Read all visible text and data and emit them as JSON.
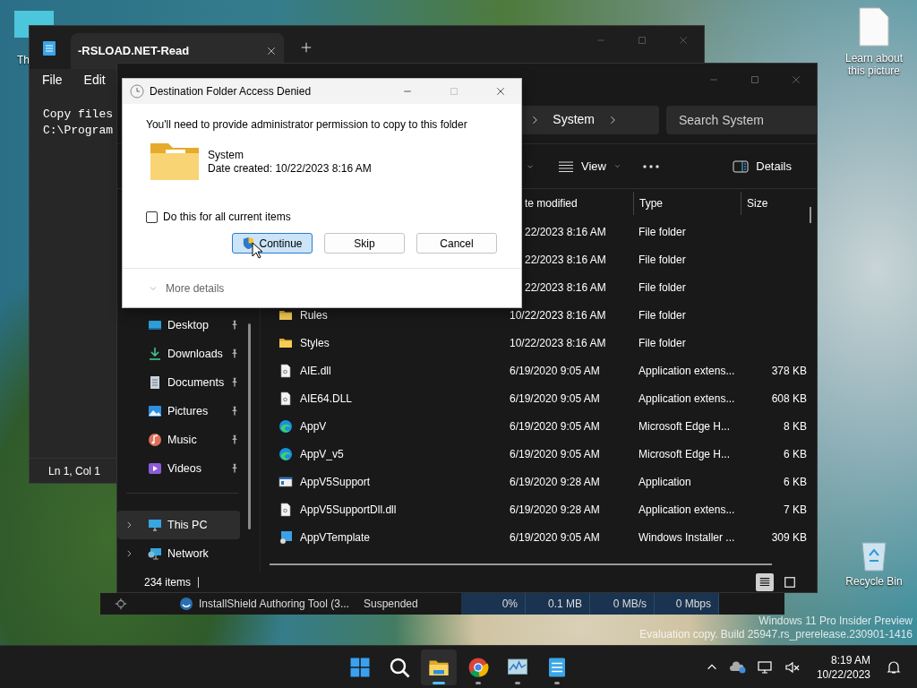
{
  "desktop": {
    "icons": [
      {
        "kind": "partial",
        "label": "Th"
      },
      {
        "kind": "document",
        "label": "Learn about this picture"
      },
      {
        "kind": "recycle",
        "label": "Recycle Bin"
      }
    ],
    "watermark": [
      "Windows 11 Pro Insider Preview",
      "Evaluation copy. Build 25947.rs_prerelease.230901-1416"
    ]
  },
  "notepad": {
    "tab": "-RSLOAD.NET-Read",
    "menu": [
      "File",
      "Edit"
    ],
    "text_lines": [
      "Copy files",
      "C:\\Program"
    ],
    "status": "Ln 1, Col 1"
  },
  "explorer": {
    "path": [
      "System"
    ],
    "search": {
      "placeholder": "Search System"
    },
    "toolbar": {
      "view": "View",
      "details": "Details"
    },
    "sidebar": [
      {
        "kind": "desktop",
        "label": "Desktop",
        "pinned": true,
        "expandable": false,
        "selected": false
      },
      {
        "kind": "downloads",
        "label": "Downloads",
        "pinned": true,
        "expandable": false,
        "selected": false
      },
      {
        "kind": "documents",
        "label": "Documents",
        "pinned": true,
        "expandable": false,
        "selected": false
      },
      {
        "kind": "pictures",
        "label": "Pictures",
        "pinned": true,
        "expandable": false,
        "selected": false
      },
      {
        "kind": "music",
        "label": "Music",
        "pinned": true,
        "expandable": false,
        "selected": false
      },
      {
        "kind": "videos",
        "label": "Videos",
        "pinned": true,
        "expandable": false,
        "selected": false
      },
      {
        "kind": "thispc",
        "label": "This PC",
        "pinned": false,
        "expandable": true,
        "selected": true
      },
      {
        "kind": "network",
        "label": "Network",
        "pinned": false,
        "expandable": true,
        "selected": false
      }
    ],
    "columns": [
      "te modified",
      "Type",
      "Size"
    ],
    "rows": [
      {
        "date": "22/2023 8:16 AM",
        "type": "File folder"
      },
      {
        "date": "22/2023 8:16 AM",
        "type": "File folder"
      },
      {
        "date": "22/2023 8:16 AM",
        "type": "File folder"
      },
      {
        "kind": "folder",
        "name": "Rules",
        "date": "10/22/2023 8:16 AM",
        "type": "File folder"
      },
      {
        "kind": "folder",
        "name": "Styles",
        "date": "10/22/2023 8:16 AM",
        "type": "File folder"
      },
      {
        "kind": "dll",
        "name": "AIE.dll",
        "date": "6/19/2020 9:05 AM",
        "type": "Application extens...",
        "size": "378 KB"
      },
      {
        "kind": "dll",
        "name": "AIE64.DLL",
        "date": "6/19/2020 9:05 AM",
        "type": "Application extens...",
        "size": "608 KB"
      },
      {
        "kind": "edge",
        "name": "AppV",
        "date": "6/19/2020 9:05 AM",
        "type": "Microsoft Edge H...",
        "size": "8 KB"
      },
      {
        "kind": "edge",
        "name": "AppV_v5",
        "date": "6/19/2020 9:05 AM",
        "type": "Microsoft Edge H...",
        "size": "6 KB"
      },
      {
        "kind": "app",
        "name": "AppV5Support",
        "date": "6/19/2020 9:28 AM",
        "type": "Application",
        "size": "6 KB"
      },
      {
        "kind": "dll",
        "name": "AppV5SupportDll.dll",
        "date": "6/19/2020 9:28 AM",
        "type": "Application extens...",
        "size": "7 KB"
      },
      {
        "kind": "msi",
        "name": "AppVTemplate",
        "date": "6/19/2020 9:05 AM",
        "type": "Windows Installer ...",
        "size": "309 KB"
      }
    ],
    "status": "234 items",
    "view_buttons": [
      {
        "kind": "details",
        "selected": true
      },
      {
        "kind": "tiles",
        "selected": false
      }
    ]
  },
  "task_manager_row": {
    "name": "InstallShield Authoring Tool (3...",
    "status": "Suspended",
    "cells": [
      "0%",
      "0.1 MB",
      "0 MB/s",
      "0 Mbps"
    ]
  },
  "dialog": {
    "title": "Destination Folder Access Denied",
    "message": "You'll need to provide administrator permission to copy to this folder",
    "item": {
      "name": "System",
      "detail": "Date created: 10/22/2023 8:16 AM"
    },
    "checkbox": {
      "label": "Do this for all current items",
      "checked": false
    },
    "buttons": [
      {
        "label": "Continue",
        "shield": true,
        "selected": true
      },
      {
        "label": "Skip",
        "shield": false,
        "selected": false
      },
      {
        "label": "Cancel",
        "shield": false,
        "selected": false
      }
    ],
    "more_details": "More details"
  },
  "taskbar": {
    "apps": [
      {
        "kind": "start",
        "running": false,
        "selected": false
      },
      {
        "kind": "search",
        "running": false,
        "selected": false
      },
      {
        "kind": "explorer",
        "running": true,
        "selected": true
      },
      {
        "kind": "chrome",
        "running": true,
        "selected": false
      },
      {
        "kind": "perfmon",
        "running": true,
        "selected": false
      },
      {
        "kind": "notepad",
        "running": true,
        "selected": false
      }
    ],
    "time": "8:19 AM",
    "date": "10/22/2023"
  }
}
